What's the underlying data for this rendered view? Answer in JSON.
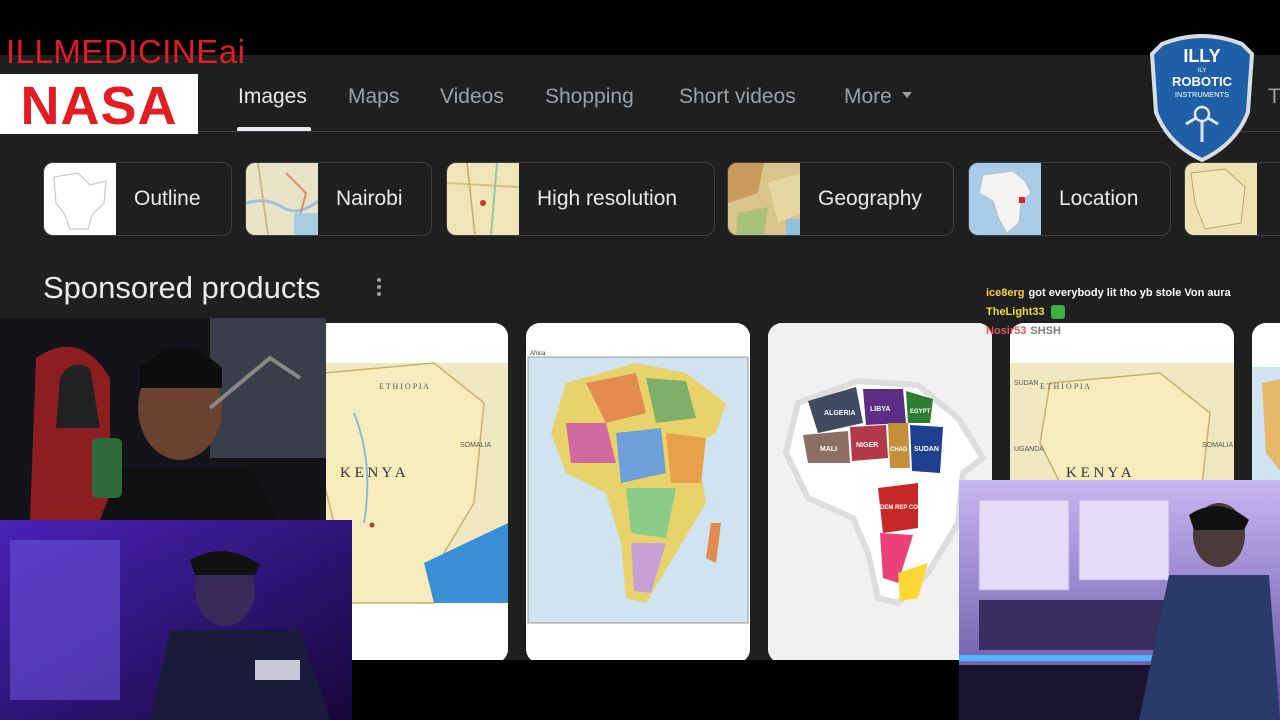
{
  "overlay": {
    "brand_text": "ILLMEDICINEai",
    "nasa_logo_text": "NASA",
    "badge": {
      "top": "ILLY",
      "small": "ILY",
      "line1": "ROBOTIC",
      "line2": "INSTRUMENTS"
    }
  },
  "tabs": [
    {
      "label": "Images",
      "active": true
    },
    {
      "label": "Maps"
    },
    {
      "label": "Videos"
    },
    {
      "label": "Shopping"
    },
    {
      "label": "Short videos"
    },
    {
      "label": "More"
    }
  ],
  "chips": [
    {
      "label": "Outline"
    },
    {
      "label": "Nairobi"
    },
    {
      "label": "High resolution"
    },
    {
      "label": "Geography"
    },
    {
      "label": "Location"
    }
  ],
  "section": {
    "title": "Sponsored products"
  },
  "products": {
    "kenya_label": "K E N Y A",
    "ethiopia_label": "E T H I O P I A",
    "somalia_label": "SOMALIA",
    "uganda_label": "UGANDA",
    "sudan_label": "SUDAN",
    "africa_label": "Africa",
    "countries": [
      "ALGERIA",
      "LIBYA",
      "EGYPT",
      "MALI",
      "NIGER",
      "SUDAN",
      "CHAD",
      "DEM REP CONGO"
    ]
  },
  "chat": [
    {
      "user": "ice8erg",
      "message": "got everybody lit tho yb stole Von aura"
    },
    {
      "user": "TheLight33",
      "message": ""
    },
    {
      "user": "Nosir53",
      "message": "SHSH"
    }
  ],
  "colors": {
    "brand_red": "#e31c23",
    "page_bg": "#1f1f1f",
    "text": "#e8eaed",
    "muted": "#9aa0a6"
  }
}
